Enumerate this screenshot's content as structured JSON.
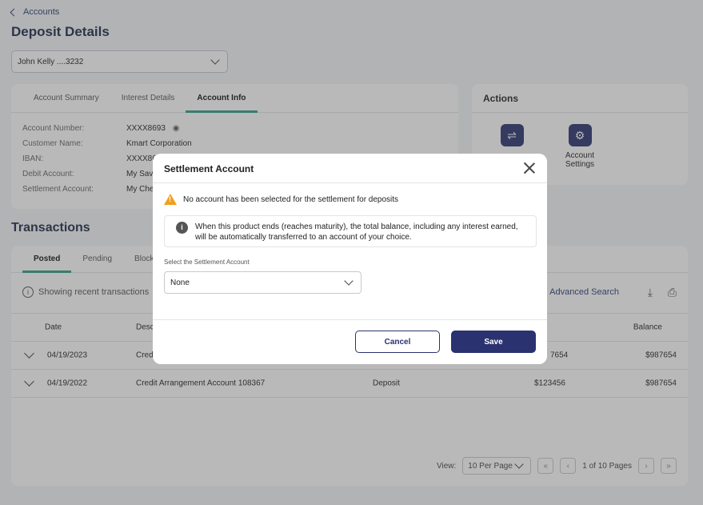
{
  "breadcrumb": {
    "label": "Accounts"
  },
  "page": {
    "title": "Deposit Details"
  },
  "account_select": {
    "value": "John Kelly ....3232"
  },
  "info_tabs": [
    "Account Summary",
    "Interest Details",
    "Account Info"
  ],
  "account_info": [
    {
      "label": "Account Number:",
      "value": "XXXX8693"
    },
    {
      "label": "Customer Name:",
      "value": "Kmart Corporation"
    },
    {
      "label": "IBAN:",
      "value": "XXXX86"
    },
    {
      "label": "Debit Account:",
      "value": "My Sav"
    },
    {
      "label": "Settlement Account:",
      "value": "My Che"
    }
  ],
  "actions": {
    "title": "Actions",
    "settings_label": "Account Settings"
  },
  "transactions": {
    "title": "Transactions",
    "tabs": [
      "Posted",
      "Pending",
      "Block"
    ],
    "showing_text": "Showing recent transactions",
    "advanced_search": "Advanced Search",
    "columns": {
      "date": "Date",
      "desc": "Desc",
      "balance": "Balance"
    },
    "rows": [
      {
        "date": "04/19/2023",
        "desc": "Cred",
        "amount": "7654",
        "balance": "$987654"
      },
      {
        "date": "04/19/2022",
        "desc": "Credit Arrangement Account 108367",
        "type": "Deposit",
        "amount": "$123456",
        "balance": "$987654"
      }
    ],
    "pager": {
      "view_label": "View:",
      "per_page": "10 Per Page",
      "pages": "1 of 10 Pages"
    }
  },
  "modal": {
    "title": "Settlement Account",
    "warning": "No account has been selected for the settlement for deposits",
    "note_line1": "When this product ends (reaches maturity), the total balance, including any interest earned,",
    "note_line2": "will be automatically transferred to an account of your choice.",
    "field_label": "Select the Settlement Account",
    "field_value": "None",
    "cancel": "Cancel",
    "save": "Save"
  },
  "colors": {
    "primary": "#2a3270",
    "accent": "#2e9e86",
    "warning": "#f0a020"
  }
}
